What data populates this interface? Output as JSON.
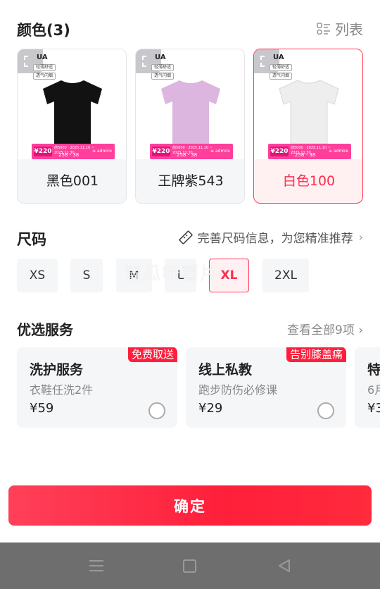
{
  "color_section": {
    "title": "颜色(3)",
    "list_toggle_label": "列表",
    "cards": [
      {
        "label": "黑色001",
        "shirt_color": "#121212",
        "selected": false
      },
      {
        "label": "王牌紫543",
        "shirt_color": "#dcb6de",
        "selected": false
      },
      {
        "label": "白色100",
        "shirt_color": "#eeeeee",
        "selected": true
      }
    ],
    "brand_mark": "UA",
    "tags": [
      "轻薄舒适",
      "透气闪烟"
    ],
    "promo": {
      "price": "¥220",
      "nums": "258  -  38",
      "logo": "≡ admire",
      "small": "前5000 · 2025.11.10 ~ 2025.11.30"
    }
  },
  "size_section": {
    "title": "尺码",
    "guide_text": "完善尺码信息，为您精准推荐",
    "sizes": [
      {
        "label": "XS",
        "selected": false
      },
      {
        "label": "S",
        "selected": false
      },
      {
        "label": "M",
        "selected": false
      },
      {
        "label": "L",
        "selected": false
      },
      {
        "label": "XL",
        "selected": true
      },
      {
        "label": "2XL",
        "selected": false
      }
    ],
    "watermark": "青瓜味薯片"
  },
  "services_section": {
    "title": "优选服务",
    "view_all": "查看全部9项 ›",
    "items": [
      {
        "name": "洗护服务",
        "desc": "衣鞋任洗2件",
        "price": "¥59",
        "badge": "免费取送"
      },
      {
        "name": "线上私教",
        "desc": "跑步防伤必修课",
        "price": "¥29",
        "badge": "告别膝盖痛"
      },
      {
        "name": "特",
        "desc": "6月",
        "price": "¥3",
        "badge": ""
      }
    ]
  },
  "confirm_label": "确定",
  "colors": {
    "accent": "#ff2c4c",
    "navbar": "#6e6e6e"
  }
}
